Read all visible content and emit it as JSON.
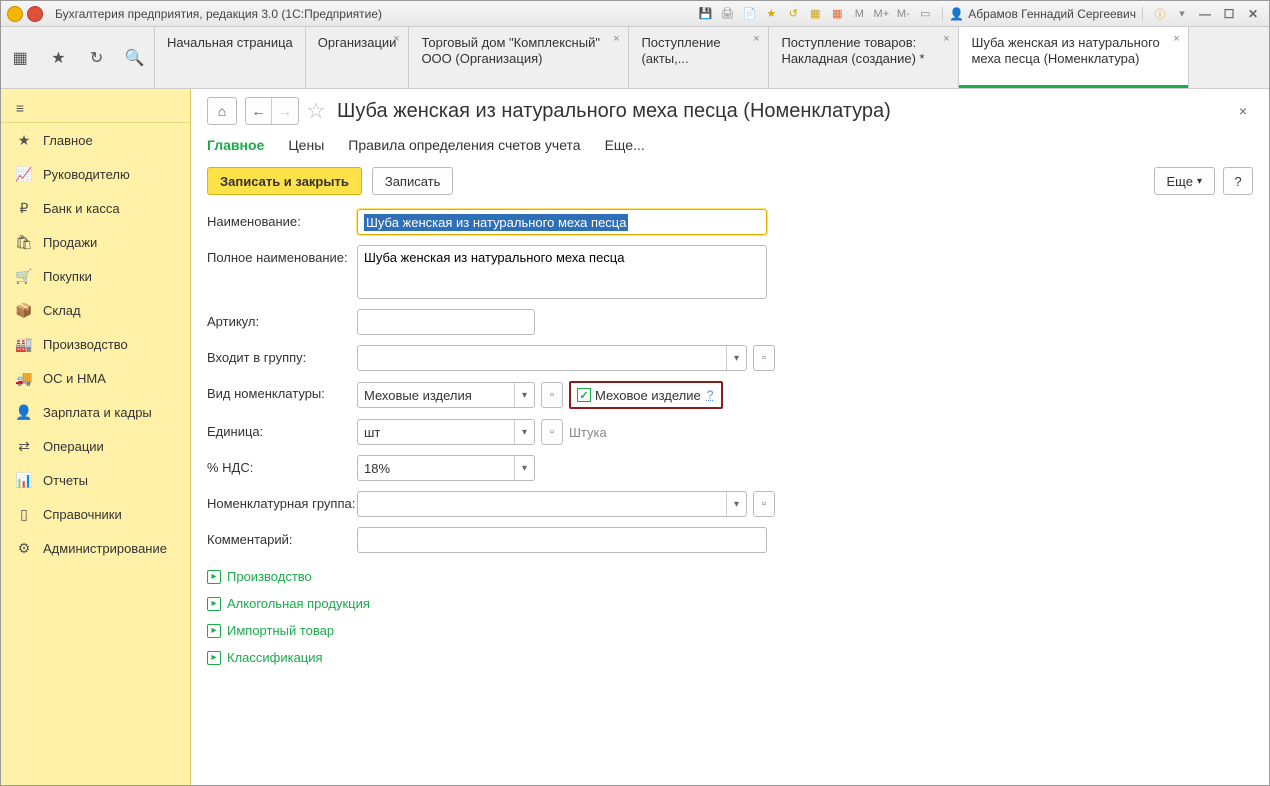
{
  "titlebar": {
    "app_title": "Бухгалтерия предприятия, редакция 3.0  (1С:Предприятие)",
    "user_name": "Абрамов Геннадий Сергеевич",
    "m_labels": [
      "М",
      "М+",
      "М-"
    ]
  },
  "main_tabs": [
    {
      "label": "Начальная страница",
      "closable": false
    },
    {
      "label": "Организации",
      "closable": true
    },
    {
      "label": "Торговый дом \"Комплексный\" ООО (Организация)",
      "closable": true
    },
    {
      "label": "Поступление (акты,...",
      "closable": true
    },
    {
      "label": "Поступление товаров: Накладная (создание) *",
      "closable": true
    },
    {
      "label": "Шуба женская из натурального меха песца (Номенклатура)",
      "closable": true,
      "active": true
    }
  ],
  "sidebar": {
    "items": [
      {
        "label": "Главное",
        "icon": "star-icon"
      },
      {
        "label": "Руководителю",
        "icon": "chart-icon"
      },
      {
        "label": "Банк и касса",
        "icon": "ruble-icon"
      },
      {
        "label": "Продажи",
        "icon": "bag-icon"
      },
      {
        "label": "Покупки",
        "icon": "cart-icon"
      },
      {
        "label": "Склад",
        "icon": "box-icon"
      },
      {
        "label": "Производство",
        "icon": "factory-icon"
      },
      {
        "label": "ОС и НМА",
        "icon": "truck-icon"
      },
      {
        "label": "Зарплата и кадры",
        "icon": "person-icon"
      },
      {
        "label": "Операции",
        "icon": "swap-icon"
      },
      {
        "label": "Отчеты",
        "icon": "bars-icon"
      },
      {
        "label": "Справочники",
        "icon": "book-icon"
      },
      {
        "label": "Администрирование",
        "icon": "gear-icon"
      }
    ]
  },
  "page": {
    "title": "Шуба женская из натурального меха песца (Номенклатура)",
    "sub_tabs": {
      "main": "Главное",
      "prices": "Цены",
      "rules": "Правила определения счетов учета",
      "more": "Еще..."
    },
    "buttons": {
      "save_close": "Записать и закрыть",
      "save": "Записать",
      "more": "Еще",
      "help": "?"
    },
    "form": {
      "labels": {
        "name": "Наименование:",
        "full_name": "Полное наименование:",
        "sku": "Артикул:",
        "group": "Входит в группу:",
        "kind": "Вид номенклатуры:",
        "unit": "Единица:",
        "vat": "% НДС:",
        "nom_group": "Номенклатурная группа:",
        "comment": "Комментарий:"
      },
      "name_value": "Шуба женская из натурального меха песца",
      "full_name_value": "Шуба женская из натурального меха песца",
      "sku_value": "",
      "group_value": "",
      "kind_value": "Меховые изделия",
      "fur_checkbox_label": "Меховое изделие",
      "unit_value": "шт",
      "unit_hint": "Штука",
      "vat_value": "18%",
      "nom_group_value": "",
      "comment_value": ""
    },
    "expanders": {
      "production": "Производство",
      "alcohol": "Алкогольная продукция",
      "import": "Импортный товар",
      "classification": "Классификация"
    }
  }
}
